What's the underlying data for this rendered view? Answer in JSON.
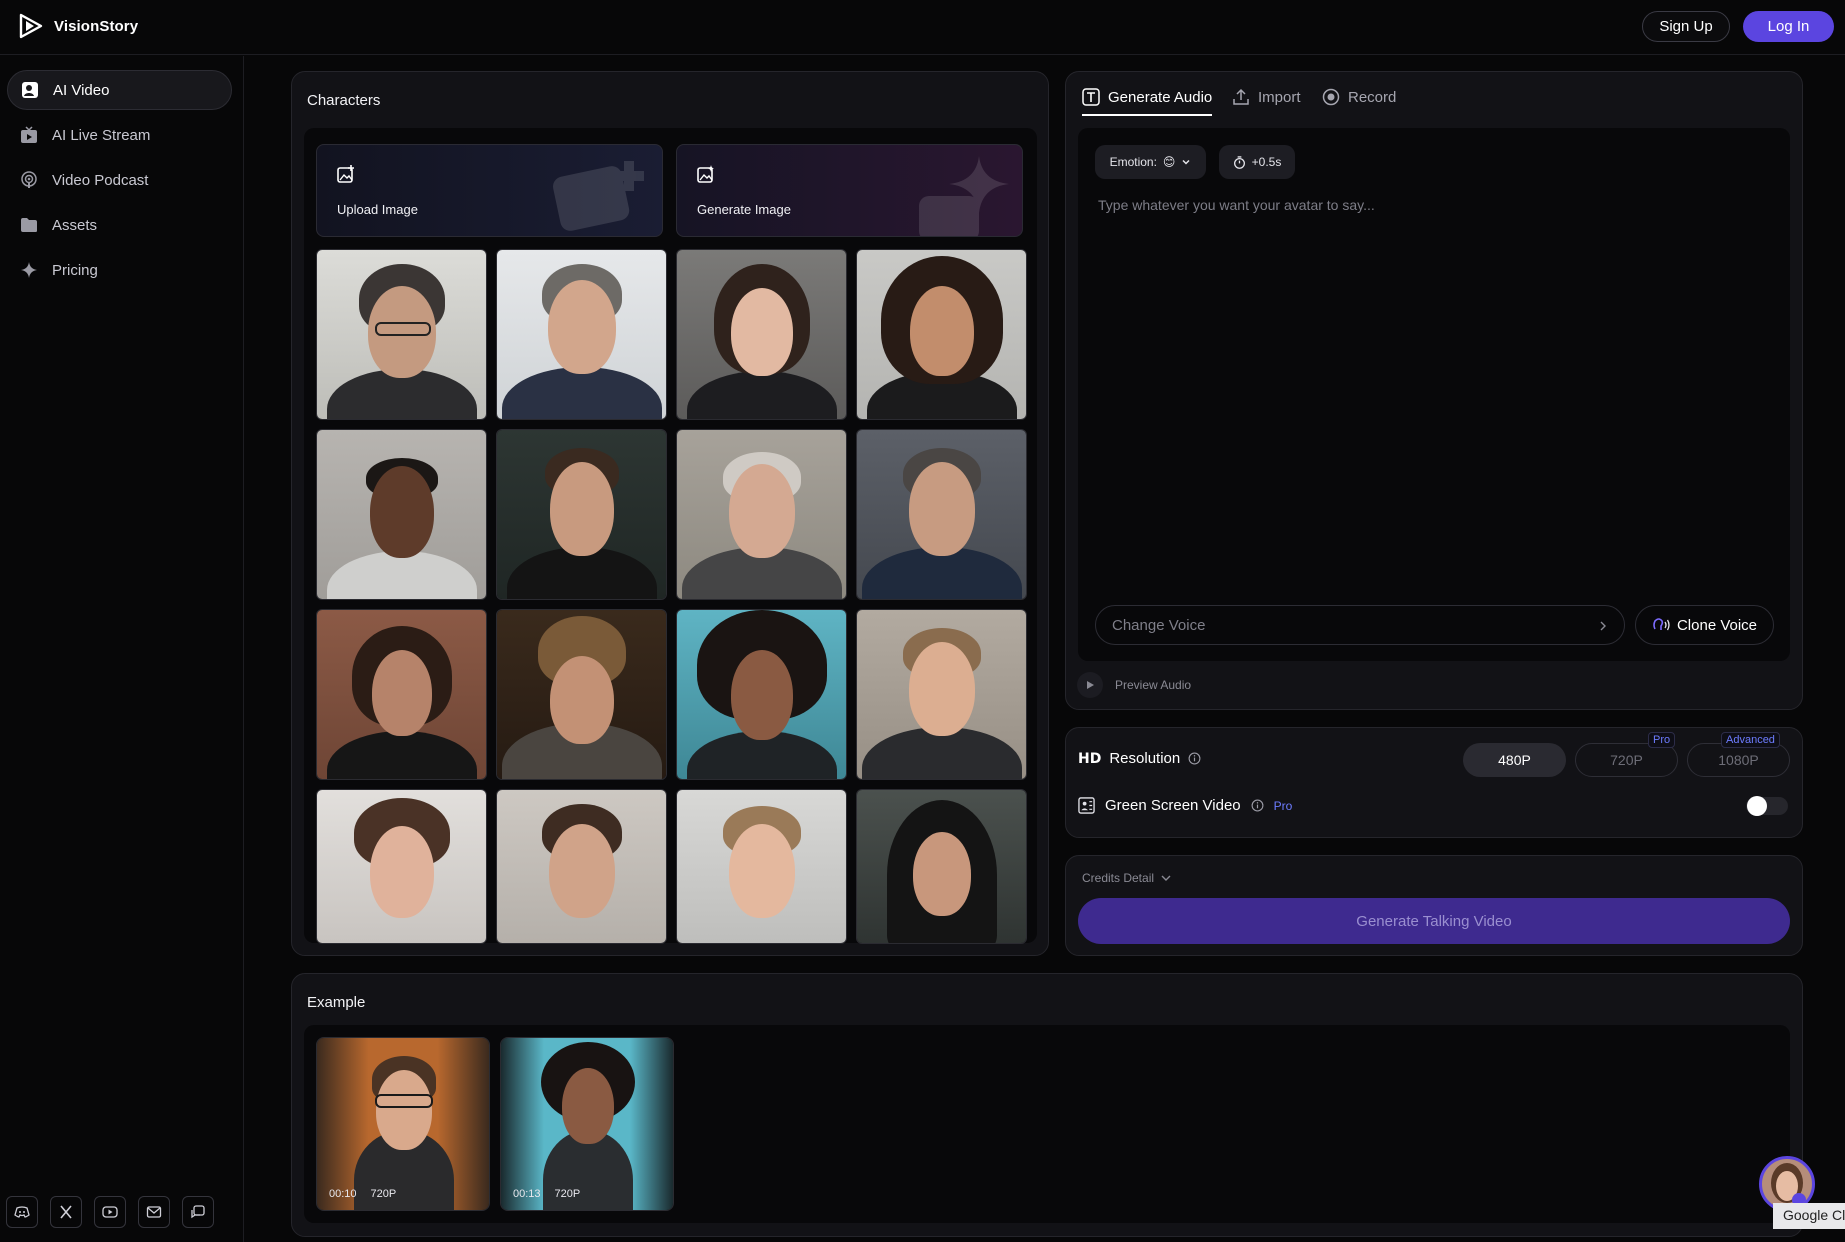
{
  "brand": {
    "name": "VisionStory",
    "logo_icon": "play-logo-icon"
  },
  "header": {
    "signup_label": "Sign Up",
    "login_label": "Log In"
  },
  "sidebar": {
    "items": [
      {
        "label": "AI Video",
        "icon": "user-square-icon",
        "active": true
      },
      {
        "label": "AI Live Stream",
        "icon": "tv-icon",
        "active": false
      },
      {
        "label": "Video Podcast",
        "icon": "podcast-icon",
        "active": false
      },
      {
        "label": "Assets",
        "icon": "folder-icon",
        "active": false
      },
      {
        "label": "Pricing",
        "icon": "sparkle-icon",
        "active": false
      }
    ],
    "social": [
      "discord-icon",
      "x-icon",
      "youtube-icon",
      "mail-icon",
      "feedback-icon"
    ]
  },
  "characters": {
    "title": "Characters",
    "upload_label": "Upload Image",
    "generate_label": "Generate Image"
  },
  "audio": {
    "tabs": [
      {
        "label": "Generate Audio",
        "icon": "text-box-icon",
        "active": true
      },
      {
        "label": "Import",
        "icon": "upload-icon",
        "active": false
      },
      {
        "label": "Record",
        "icon": "record-icon",
        "active": false
      }
    ],
    "emotion_label": "Emotion:",
    "emotion_value": "😊",
    "pause_label": "+0.5s",
    "placeholder": "Type whatever you want your avatar to say...",
    "change_voice_placeholder": "Change Voice",
    "clone_voice_label": "Clone Voice",
    "preview_label": "Preview Audio"
  },
  "resolution": {
    "hd_label": "HD",
    "label": "Resolution",
    "options": [
      {
        "label": "480P",
        "selected": true,
        "badge": ""
      },
      {
        "label": "720P",
        "selected": false,
        "badge": "Pro"
      },
      {
        "label": "1080P",
        "selected": false,
        "badge": "Advanced"
      }
    ]
  },
  "green_screen": {
    "label": "Green Screen Video",
    "badge": "Pro",
    "enabled": false
  },
  "credits": {
    "label": "Credits Detail",
    "generate_label": "Generate Talking Video"
  },
  "example": {
    "title": "Example",
    "items": [
      {
        "duration": "00:10",
        "resolution": "720P"
      },
      {
        "duration": "00:13",
        "resolution": "720P"
      }
    ]
  },
  "google_tag": "Google Cl",
  "colors": {
    "accent": "#5b45e0",
    "background": "#070708",
    "panel": "#121216"
  }
}
